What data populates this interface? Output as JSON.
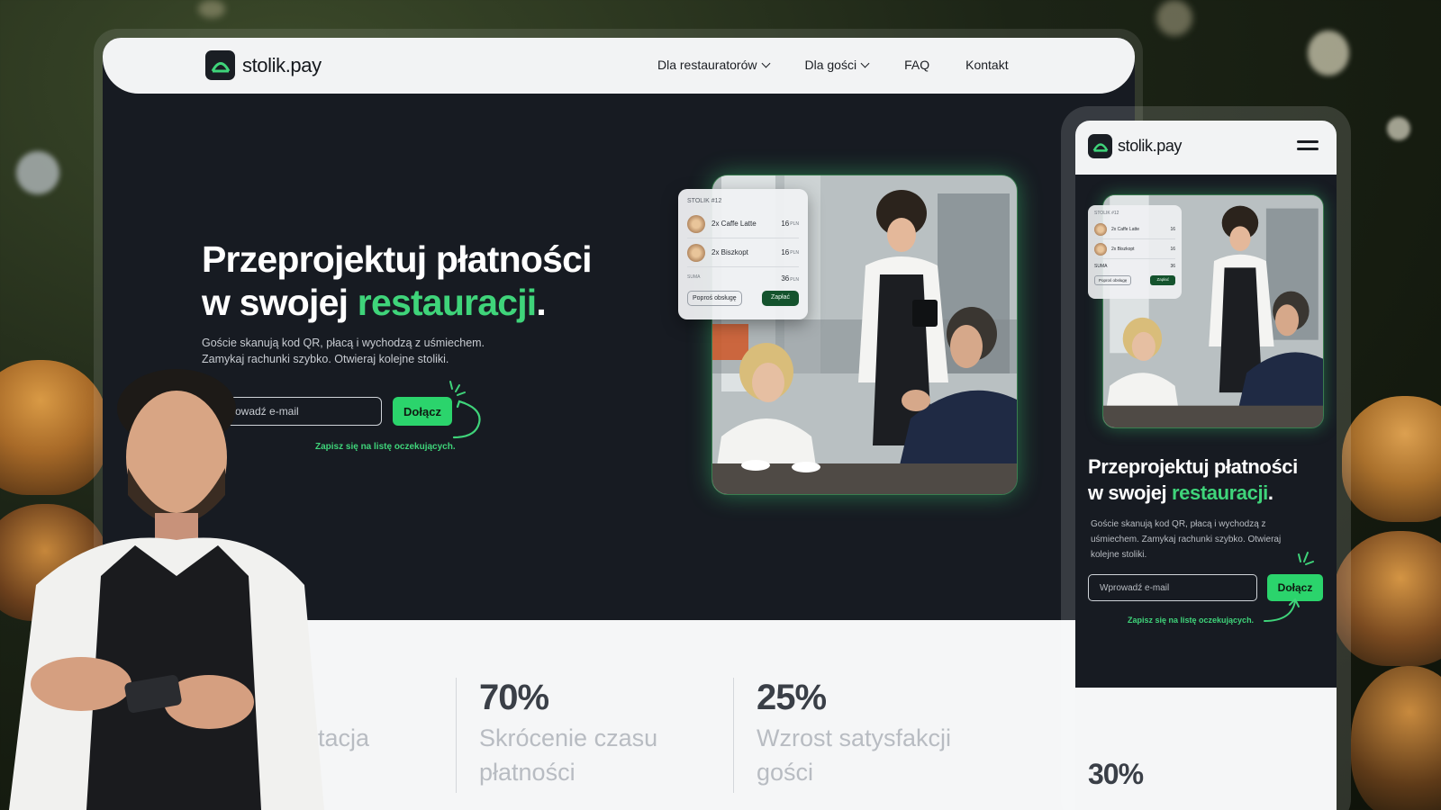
{
  "brand": {
    "name": "stolik.pay",
    "accent": "#3fd47a",
    "button": "#2bd46c",
    "dark": "#171b22"
  },
  "nav": {
    "items": [
      {
        "label": "Dla restauratorów",
        "has_dropdown": true
      },
      {
        "label": "Dla gości",
        "has_dropdown": true
      },
      {
        "label": "FAQ",
        "has_dropdown": false
      },
      {
        "label": "Kontakt",
        "has_dropdown": false
      }
    ]
  },
  "hero": {
    "title_line1": "Przeprojektuj płatności",
    "title_line2_prefix": "w swojej ",
    "title_accent": "restauracji",
    "title_suffix": ".",
    "subtitle_line1": "Goście skanują kod QR, płacą i wychodzą z uśmiechem.",
    "subtitle_line2": "Zamykaj rachunki szybko. Otwieraj kolejne stoliki.",
    "email_placeholder": "Wprowadź e-mail",
    "cta_label": "Dołącz",
    "waitlist_note": "Zapisz się na listę oczekujących."
  },
  "order_card": {
    "title": "STOLIK #12",
    "items": [
      {
        "name": "2x Caffe Latte",
        "price": "16",
        "currency": "PLN"
      },
      {
        "name": "2x Biszkopt",
        "price": "16",
        "currency": "PLN"
      }
    ],
    "sum_label": "SUMA",
    "sum_value": "36",
    "sum_currency": "PLN",
    "call_service_label": "Poproś obsługę",
    "pay_label": "Zapłać"
  },
  "stats": [
    {
      "value": "",
      "label_line1": "rotacja",
      "label_line2": ""
    },
    {
      "value": "70%",
      "label_line1": "Skrócenie czasu",
      "label_line2": "płatności"
    },
    {
      "value": "25%",
      "label_line1": "Wzrost satysfakcji",
      "label_line2": "gości"
    }
  ],
  "mobile": {
    "brand": "stolik.pay",
    "order_title": "STOLIK #12",
    "title_line1": "Przeprojektuj płatności",
    "title_line2_prefix": "w swojej ",
    "title_accent": "restauracji",
    "title_suffix": ".",
    "subtitle": "Goście skanują kod QR, płacą i wychodzą z uśmiechem. Zamykaj rachunki szybko. Otwieraj kolejne stoliki.",
    "email_placeholder": "Wprowadź e-mail",
    "cta_label": "Dołącz",
    "waitlist_note": "Zapisz się na listę oczekujących.",
    "stat_value": "30%"
  },
  "icons": [
    "logo-icon",
    "chevron-down-icon",
    "hamburger-menu-icon",
    "arrow-doodle-icon",
    "coffee-icon",
    "cake-icon"
  ]
}
